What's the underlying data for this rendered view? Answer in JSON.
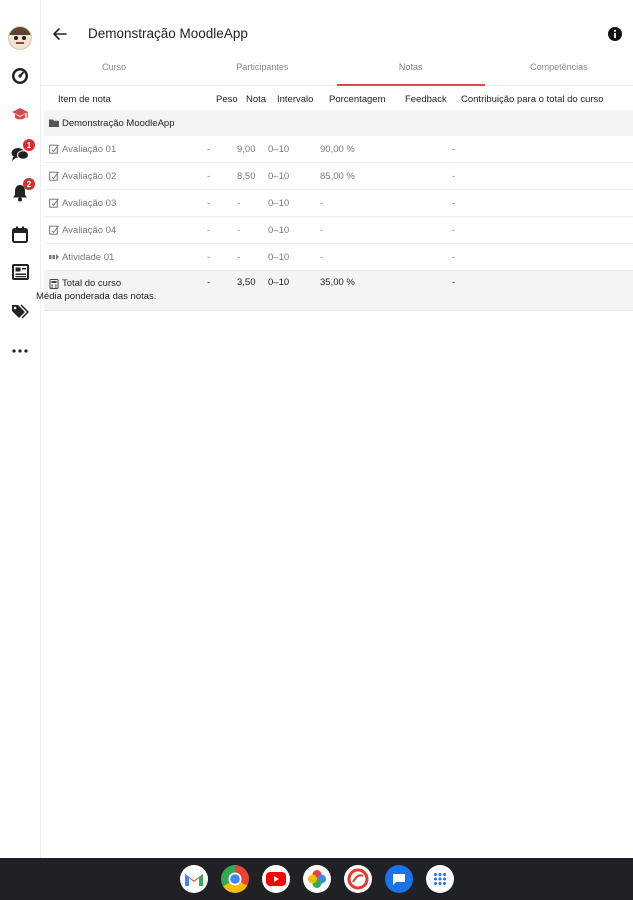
{
  "header": {
    "title": "Demonstração MoodleApp"
  },
  "tabs": [
    {
      "label": "Curso"
    },
    {
      "label": "Participantes"
    },
    {
      "label": "Notas"
    },
    {
      "label": "Competências"
    }
  ],
  "badges": {
    "messages": "1",
    "notifications": "2"
  },
  "table": {
    "headers": {
      "item": "Item de nota",
      "peso": "Peso",
      "nota": "Nota",
      "intervalo": "Intervalo",
      "porcentagem": "Porcentagem",
      "feedback": "Feedback",
      "contribuicao": "Contribuição para o total do curso"
    },
    "category": "Demonstração MoodleApp",
    "rows": [
      {
        "item": "Avaliação 01",
        "peso": "-",
        "nota": "9,00",
        "intervalo": "0–10",
        "porcentagem": "90,00 %",
        "feedback": "",
        "contribuicao": "-"
      },
      {
        "item": "Avaliação 02",
        "peso": "-",
        "nota": "8,50",
        "intervalo": "0–10",
        "porcentagem": "85,00 %",
        "feedback": "",
        "contribuicao": "-"
      },
      {
        "item": "Avaliação 03",
        "peso": "-",
        "nota": "-",
        "intervalo": "0–10",
        "porcentagem": "-",
        "feedback": "",
        "contribuicao": "-"
      },
      {
        "item": "Avaliação 04",
        "peso": "-",
        "nota": "-",
        "intervalo": "0–10",
        "porcentagem": "-",
        "feedback": "",
        "contribuicao": "-"
      },
      {
        "item": "Atividade 01",
        "peso": "-",
        "nota": "-",
        "intervalo": "0–10",
        "porcentagem": "-",
        "feedback": "",
        "contribuicao": "-"
      }
    ],
    "total": {
      "item": "Total do curso",
      "subtitle": "Média ponderada das notas.",
      "peso": "-",
      "nota": "3,50",
      "intervalo": "0–10",
      "porcentagem": "35,00 %",
      "feedback": "",
      "contribuicao": "-"
    }
  },
  "colors": {
    "accent": "#d84848",
    "badge": "#d32f2f",
    "shelf": "#202124"
  },
  "icons": {
    "rail": [
      "avatar",
      "dashboard-icon",
      "graduation-cap-icon",
      "messages-icon",
      "notifications-bell-icon",
      "calendar-icon",
      "news-icon",
      "tags-icon",
      "more-icon"
    ],
    "shelf": [
      "gmail-icon",
      "chrome-icon",
      "youtube-icon",
      "photos-icon",
      "moodle-app-icon",
      "messages-app-icon",
      "app-launcher-icon"
    ]
  }
}
